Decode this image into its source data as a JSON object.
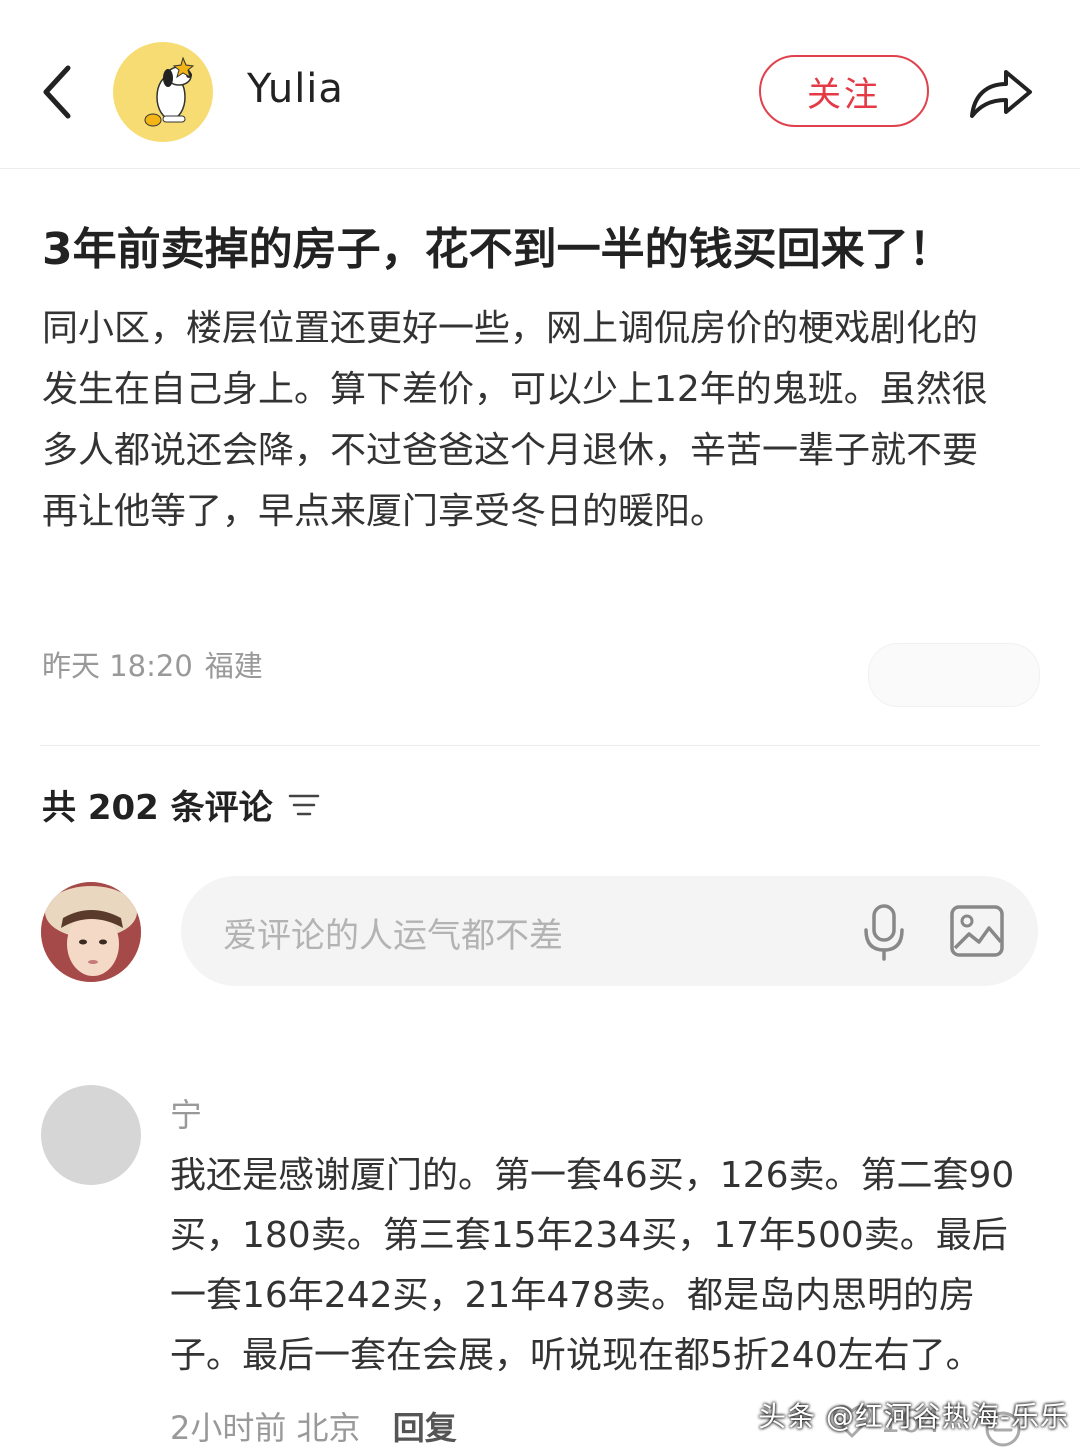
{
  "header": {
    "username": "Yulia",
    "follow_label": "关注"
  },
  "post": {
    "title": "3年前卖掉的房子，花不到一半的钱买回来了！",
    "body": "同小区，楼层位置还更好一些，网上调侃房价的梗戏剧化的发生在自己身上。算下差价，可以少上12年的鬼班。虽然很多人都说还会降，不过爸爸这个月退休，辛苦一辈子就不要再让他等了，早点来厦门享受冬日的暖阳。",
    "time": "昨天 18:20",
    "location": "福建"
  },
  "comments_section": {
    "count_label": "共 202 条评论",
    "input_placeholder": "爱评论的人运气都不差"
  },
  "comments": [
    {
      "name": "宁",
      "text": "我还是感谢厦门的。第一套46买，126卖。第二套90买，180卖。第三套15年234买，17年500卖。最后一套16年242买，21年478卖。都是岛内思明的房子。最后一套在会展，听说现在都5折240左右了。",
      "time": "2小时前",
      "location": "北京",
      "reply_label": "回复",
      "likes": "164"
    }
  ],
  "watermark": "头条 @红河谷热海-乐乐",
  "colors": {
    "accent": "#e33a45"
  }
}
